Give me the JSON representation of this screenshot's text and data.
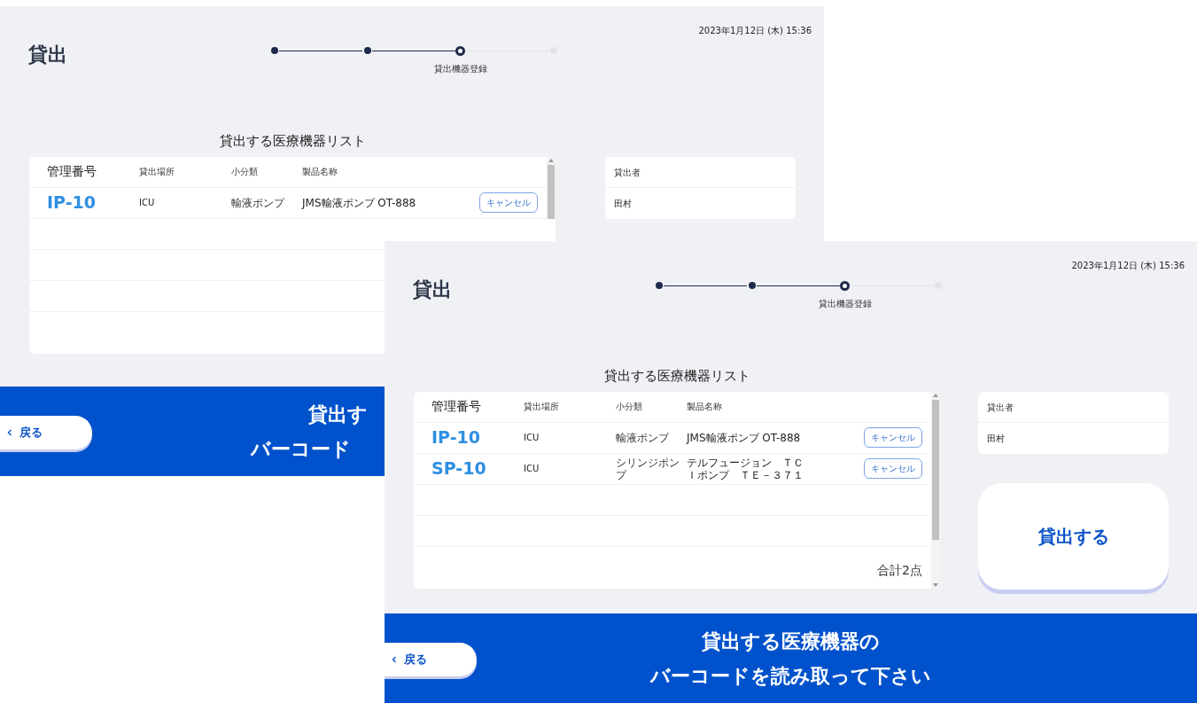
{
  "screens": [
    {
      "title": "貸出",
      "datetime": "2023年1月12日 (木) 15:36",
      "steps": [
        {
          "done": true,
          "selected": false
        },
        {
          "done": true,
          "selected": false
        },
        {
          "done": false,
          "selected": true,
          "label": "貸出機器登録"
        },
        {
          "done": false,
          "selected": false
        }
      ],
      "list_title": "貸出する医療機器リスト",
      "table": {
        "columns": [
          "管理番号",
          "貸出場所",
          "小分類",
          "製品名称"
        ],
        "rows": [
          {
            "id": "IP-10",
            "location": "ICU",
            "category": "輸液ポンプ",
            "product": "JMS輸液ポンプ OT-888",
            "action": "キャンセル"
          }
        ]
      },
      "lender": {
        "label": "貸出者",
        "value": "田村"
      },
      "back_button": "戻る",
      "prompt": [
        "貸出す",
        "バーコード"
      ]
    },
    {
      "title": "貸出",
      "datetime": "2023年1月12日 (木) 15:36",
      "steps": [
        {
          "done": true,
          "selected": false
        },
        {
          "done": true,
          "selected": false
        },
        {
          "done": false,
          "selected": true,
          "label": "貸出機器登録"
        },
        {
          "done": false,
          "selected": false
        }
      ],
      "list_title": "貸出する医療機器リスト",
      "table": {
        "columns": [
          "管理番号",
          "貸出場所",
          "小分類",
          "製品名称"
        ],
        "rows": [
          {
            "id": "IP-10",
            "location": "ICU",
            "category": "輸液ポンプ",
            "product": "JMS輸液ポンプ OT-888",
            "action": "キャンセル"
          },
          {
            "id": "SP-10",
            "location": "ICU",
            "category": "シリンジポンプ",
            "product": "テルフュージョン　ＴＣＩポンプ　ＴＥ－３７１",
            "action": "キャンセル"
          }
        ],
        "total": "合計2点"
      },
      "lender": {
        "label": "貸出者",
        "value": "田村"
      },
      "submit_button": "貸出する",
      "back_button": "戻る",
      "prompt": [
        "貸出する医療機器の",
        "バーコードを読み取って下さい"
      ]
    }
  ]
}
